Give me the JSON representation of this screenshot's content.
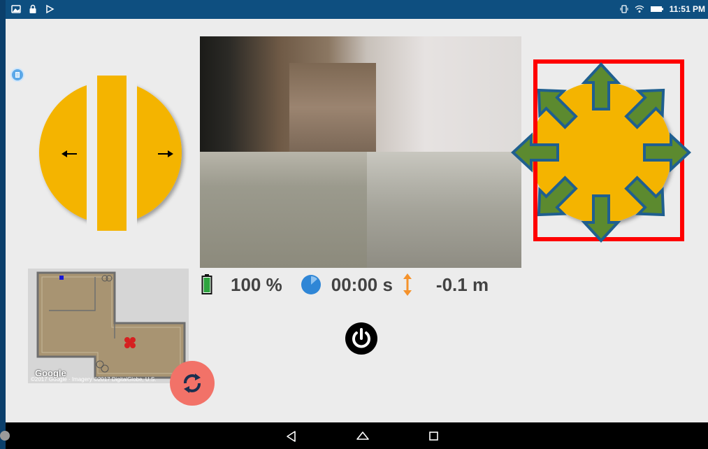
{
  "status_bar": {
    "time": "11:51 PM",
    "left_icons": [
      "gallery-icon",
      "lock-icon",
      "play-store-icon"
    ],
    "right_icons": [
      "vibrate-icon",
      "wifi-icon",
      "battery-icon"
    ]
  },
  "stats": {
    "battery": "100 %",
    "timer": "00:00 s",
    "altitude": "-0.1 m"
  },
  "map": {
    "logo": "Google",
    "attribution": "©2017 Google · Imagery ©2017 DigitalGlobe, U.S."
  },
  "colors": {
    "joystick_yellow": "#f4b400",
    "arrow_green": "#5c8a2f",
    "arrow_outline": "#1f5f8f",
    "highlight_red": "#ff0000",
    "refresh_red": "#f27268"
  },
  "nav_bar": {
    "buttons": [
      "back-icon",
      "home-icon",
      "recents-icon"
    ]
  }
}
